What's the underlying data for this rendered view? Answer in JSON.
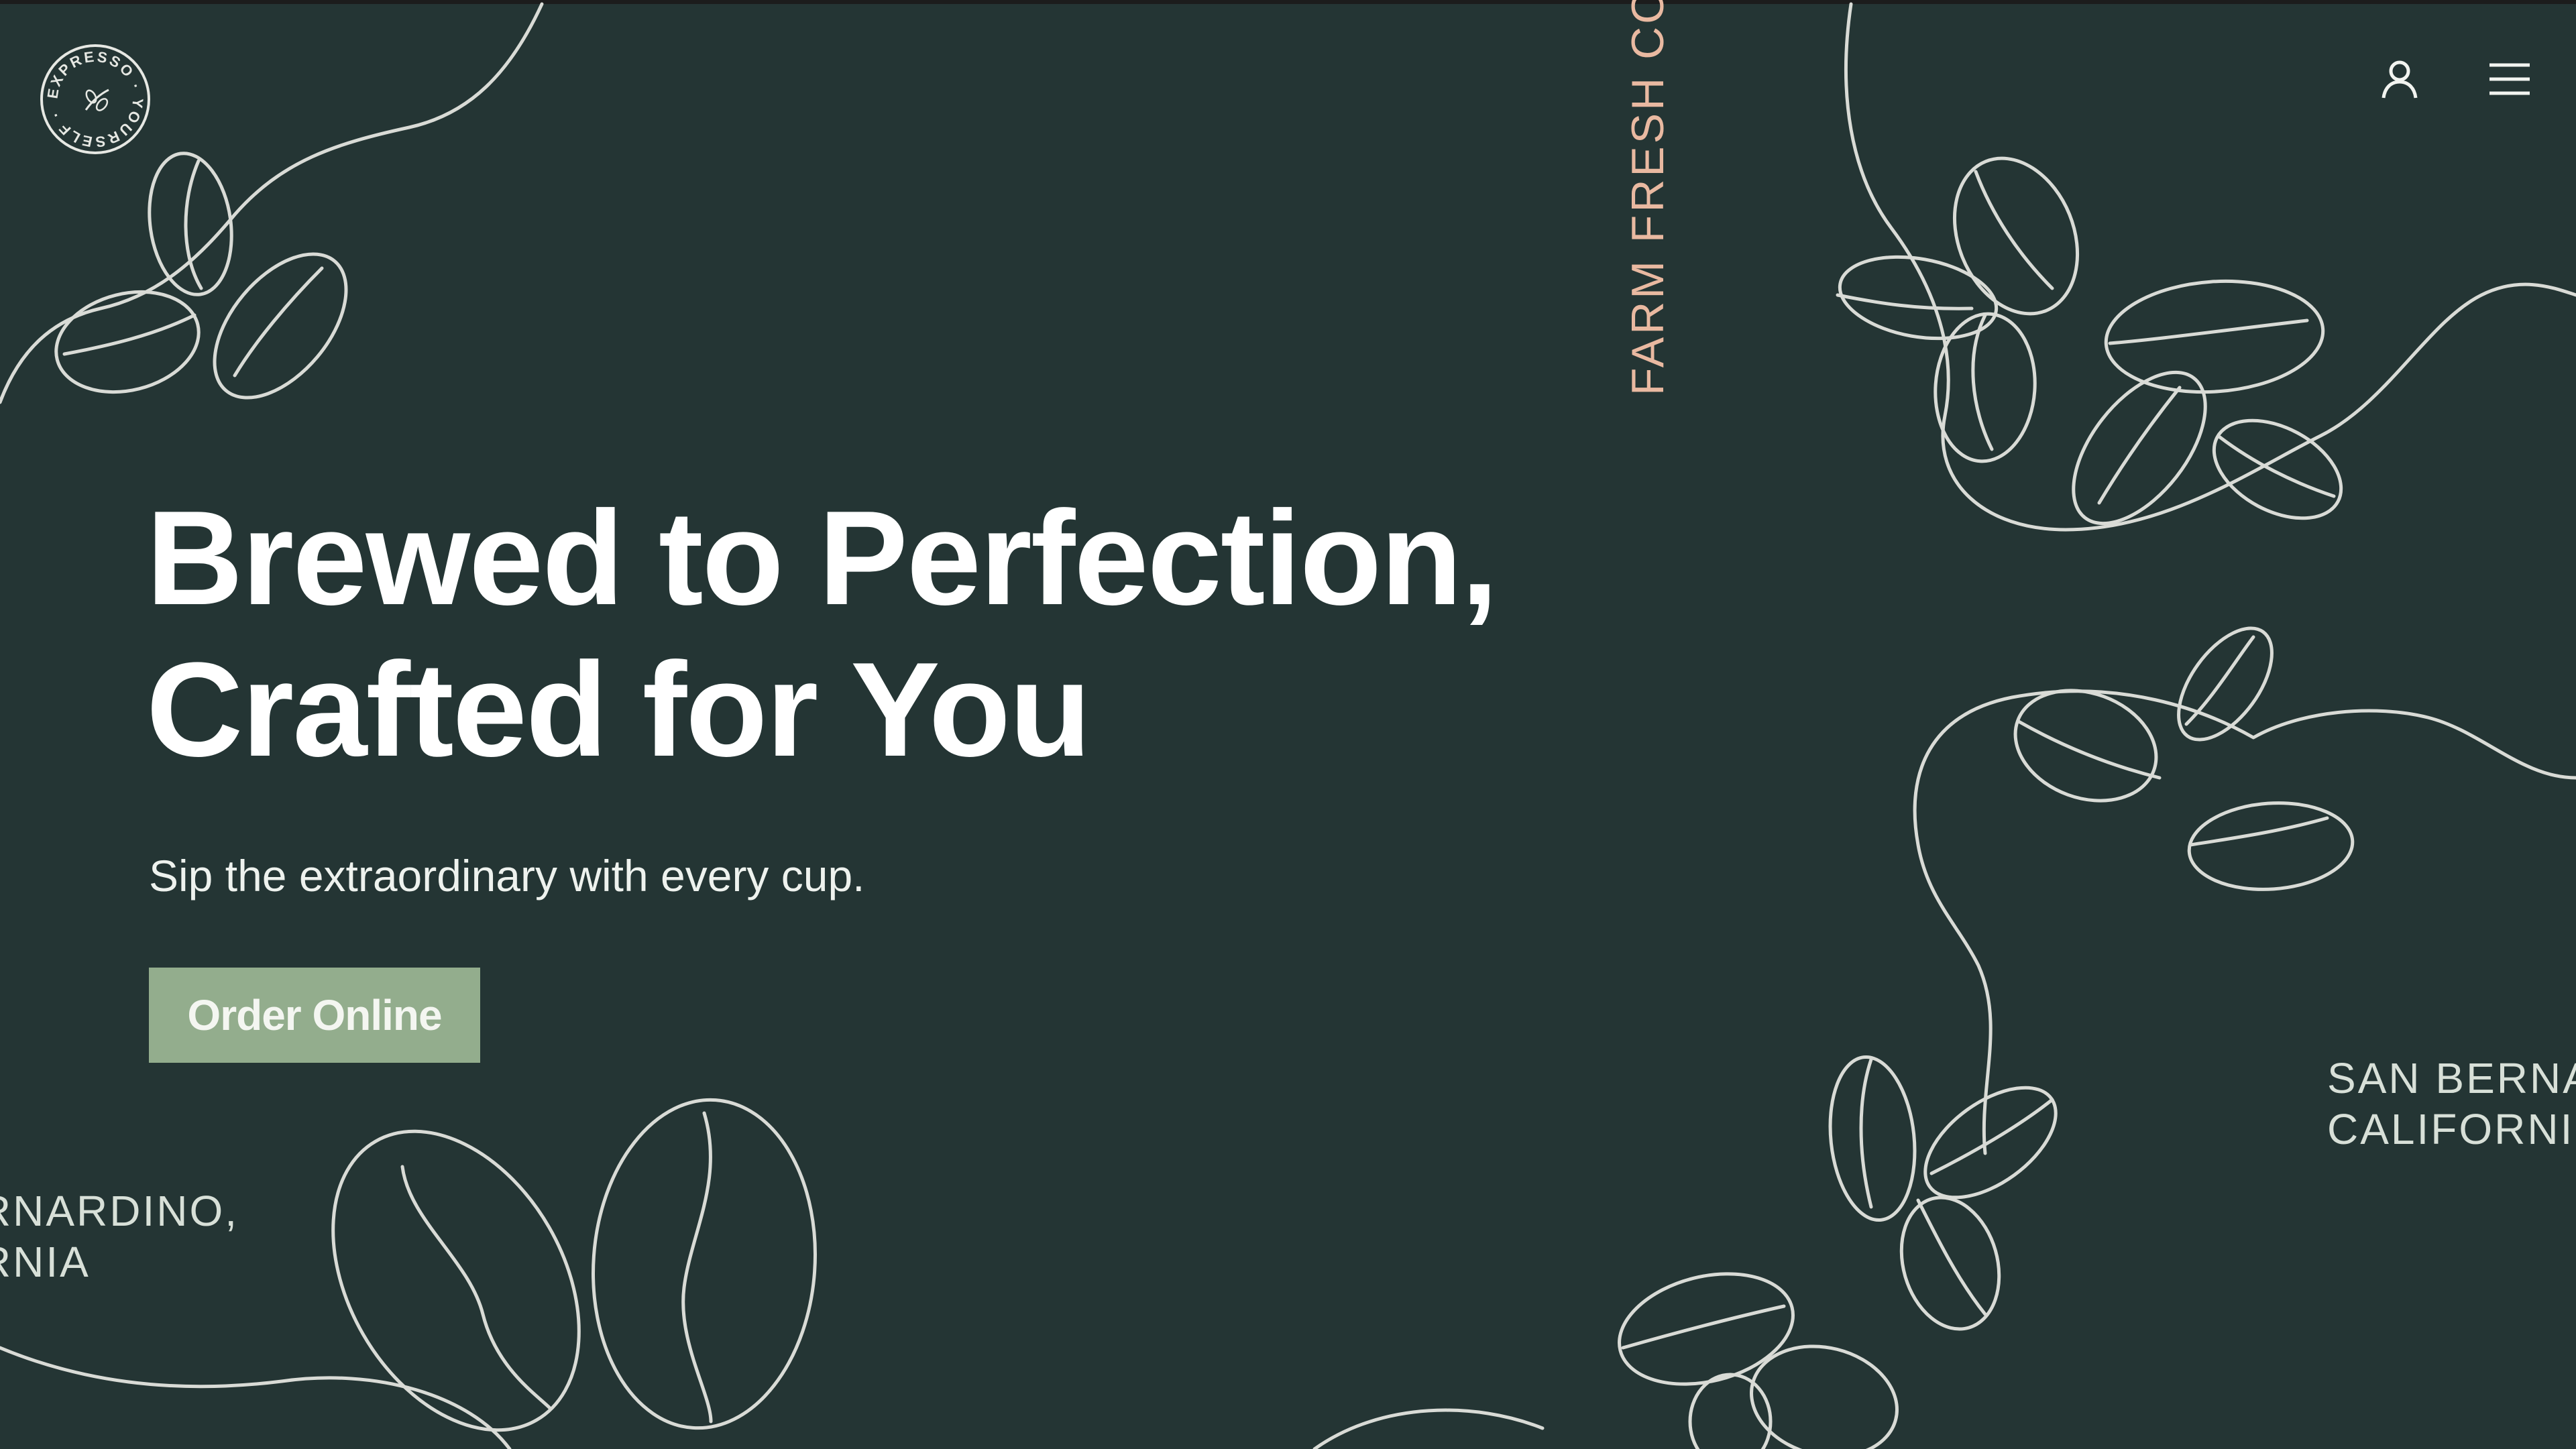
{
  "brand": {
    "logo_text": "EXPRESSO · YOURSELF ·"
  },
  "nav": {
    "account_icon": "user-icon",
    "menu_icon": "hamburger-menu-icon"
  },
  "hero": {
    "headline_line1": "Brewed to Perfection,",
    "headline_line2": "Crafted for You",
    "subheadline": "Sip the extraordinary with every cup.",
    "cta_label": "Order Online"
  },
  "marquee": {
    "vertical_text": "FARM FRESH COF",
    "location_left_line1": "RNARDINO,",
    "location_left_line2": "RNIA",
    "location_right_line1": "SAN BERNA",
    "location_right_line2": "CALIFORNI"
  },
  "colors": {
    "background": "#243534",
    "accent_button": "#93ad8d",
    "vertical_text": "#e9b9a1",
    "doodle_stroke": "#d9dbd6"
  }
}
